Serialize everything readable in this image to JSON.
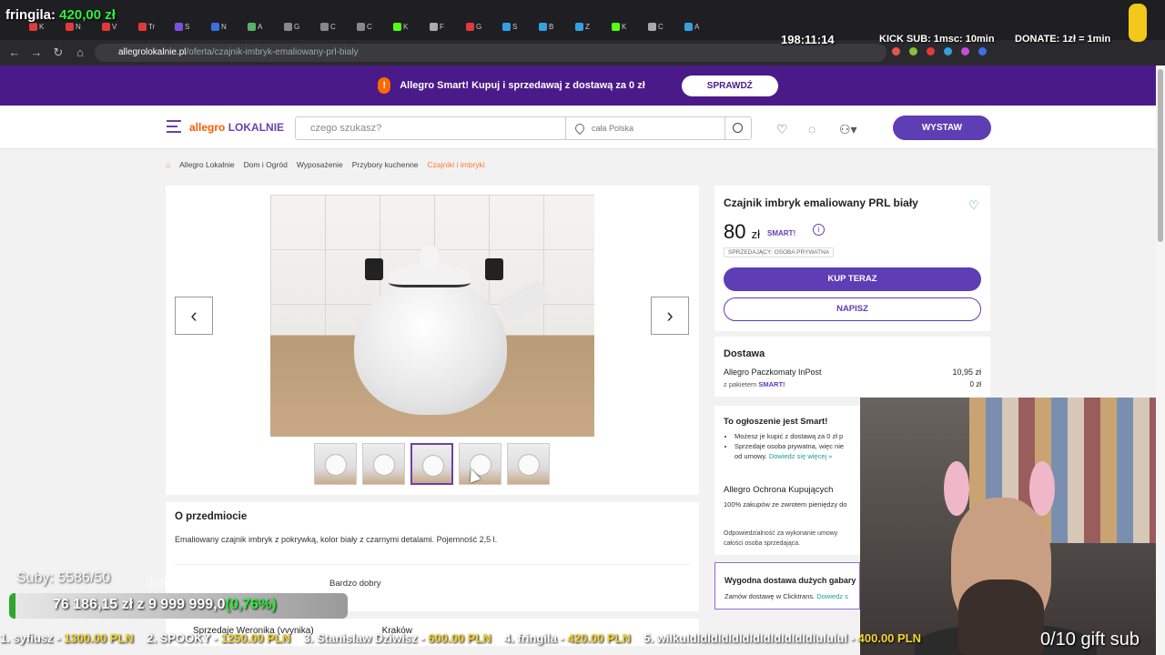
{
  "browser": {
    "tabs": [
      "K",
      "N",
      "V",
      "Tr",
      "S",
      "N",
      "A",
      "G",
      "C",
      "C",
      "K",
      "F",
      "G",
      "S",
      "B",
      "Z",
      "K",
      "C",
      "A"
    ],
    "url_host": "allegrolokalnie.pl",
    "url_path": "/oferta/czajnik-imbryk-emaliowany-prl-bialy"
  },
  "promo": {
    "text": "Allegro Smart! Kupuj i sprzedawaj z dostawą za 0 zł",
    "button": "SPRAWDŹ"
  },
  "header": {
    "logo_a": "allegro",
    "logo_b": "LOKALNIE",
    "search_placeholder": "czego szukasz?",
    "location": "cała Polska",
    "post_button": "WYSTAW"
  },
  "breadcrumb": [
    "Allegro Lokalnie",
    "Dom i Ogród",
    "Wyposażenie",
    "Przybory kuchenne",
    "Czajniki i imbryki"
  ],
  "offer": {
    "title": "Czajnik imbryk emaliowany PRL biały",
    "price": "80",
    "currency": "zł",
    "smart": "SMART!",
    "seller_type": "SPRZEDAJĄCY: OSOBA PRYWATNA",
    "buy_button": "KUP TERAZ",
    "message_button": "NAPISZ"
  },
  "delivery": {
    "title": "Dostawa",
    "method": "Allegro Paczkomaty InPost",
    "price": "10,95 zł",
    "smart_prefix": "z pakietem",
    "smart_price": "0 zł"
  },
  "smart_box": {
    "title": "To ogłoszenie jest Smart!",
    "item1": "Możesz je kupić z dostawą za 0 zł p",
    "item2": "Sprzedaje osoba prywatna, więc nie",
    "item3_text": "od umowy.",
    "item3_link": "Dowiedz się więcej »",
    "protect_title": "Allegro Ochrona Kupujących",
    "protect_text": "100% zakupów ze zwrotem pieniędzy do",
    "responsibility": "Odpowiedzialność za wykonanie umowy",
    "responsibility2": "całości osoba sprzedająca."
  },
  "big_box": {
    "title": "Wygodna dostawa dużych gabary",
    "text": "Zamów dostawę w Clicktrans.",
    "link": "Dowiedz s"
  },
  "about": {
    "title": "O przedmiocie",
    "description": "Emaliowany czajnik imbryk z pokrywką, kolor biały z czarnymi detalami. Pojemność 2,5 l.",
    "condition": "Bardzo dobry"
  },
  "seller_line": "Sprzedaje Weronika (vvynika)",
  "seller_city": "Kraków",
  "gallery": {
    "thumbs": 5,
    "selected": 3
  },
  "overlay": {
    "name": "fringila:",
    "amount": "420,00 zł",
    "timer": "198:11:14",
    "kick": "KICK SUB: 1msc: 10min",
    "donate": "DONATE: 1zł = 1min",
    "subs": "Suby: 5586/50",
    "kolo": "!koło",
    "bar_text": "76 186,15 zł z  9 999 999,0",
    "bar_pct": "(0,76%)",
    "bar_fraction": 0.0076,
    "ticker": [
      {
        "name": "1. syfiusz - ",
        "amt": "1300.00 PLN"
      },
      {
        "name": "2. SPOOKY - ",
        "amt": "1250.00 PLN"
      },
      {
        "name": "3. Stanislaw Dziwisz - ",
        "amt": "600.00 PLN"
      },
      {
        "name": "4. fringila - ",
        "amt": "420.00 PLN"
      },
      {
        "name": "5. wiIkuIdIdIdIdIdIdIdIdIdIdIdIdIululul - ",
        "amt": "400.00 PLN"
      }
    ],
    "gift": "0/10 gift sub"
  },
  "colors": {
    "brand_purple": "#5e3db5",
    "promo_bg": "#4b1a89",
    "logo_orange": "#ff5a00",
    "accent_green": "#2ef03a"
  }
}
